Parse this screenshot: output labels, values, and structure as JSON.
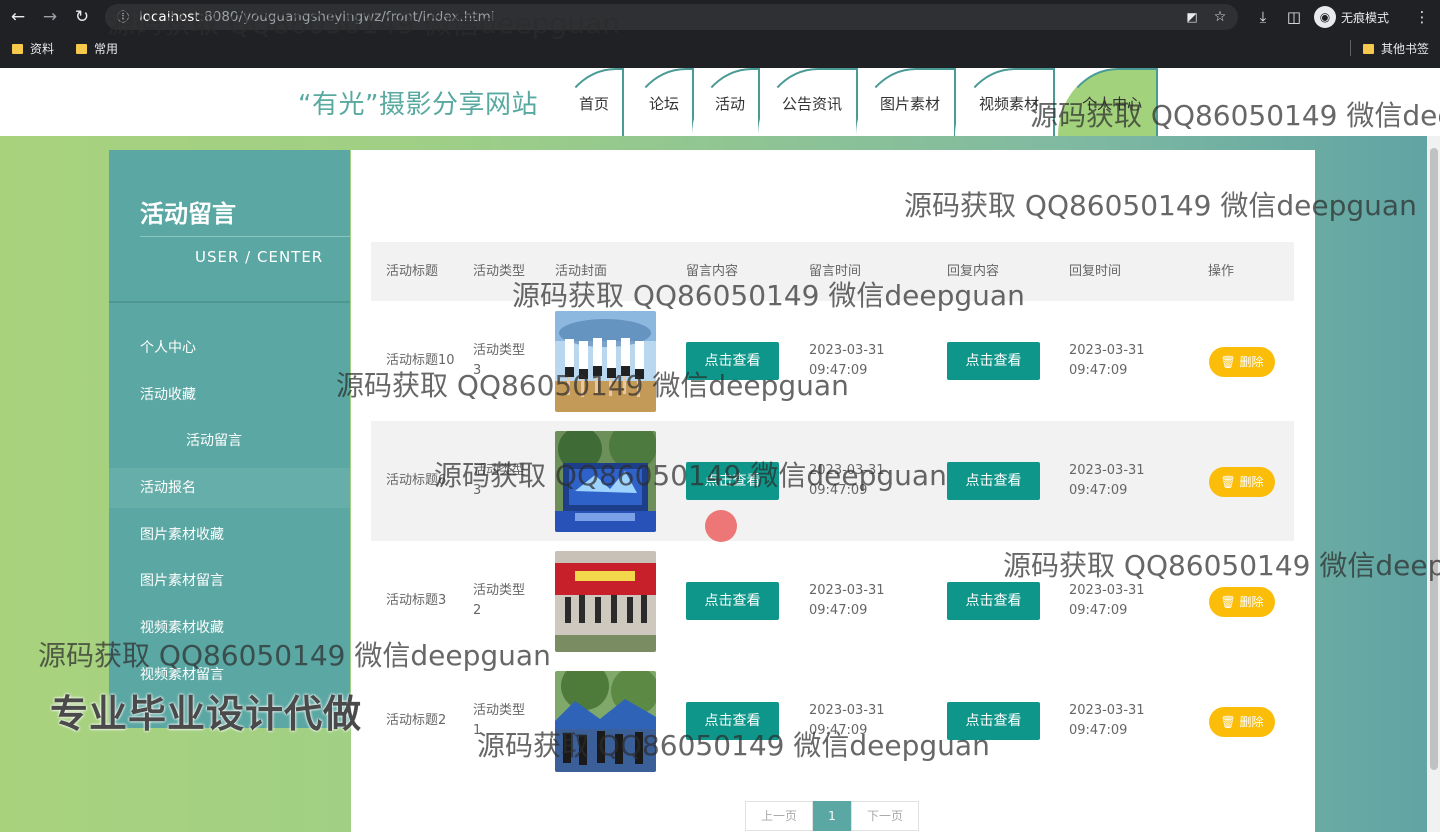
{
  "browser": {
    "url_host": "localhost",
    "url_path": ":8080/youguangsheyingwz/front/index.html",
    "incognito_label": "无痕模式",
    "bookmarks": [
      "资料",
      "常用"
    ],
    "other_bookmarks": "其他书签"
  },
  "site": {
    "title": "“有光”摄影分享网站",
    "nav": [
      "首页",
      "论坛",
      "活动",
      "公告资讯",
      "图片素材",
      "视频素材",
      "个人中心"
    ]
  },
  "sidebar": {
    "title": "活动留言",
    "subtitle": "USER / CENTER",
    "items": [
      "个人中心",
      "活动收藏",
      "活动留言",
      "活动报名",
      "图片素材收藏",
      "图片素材留言",
      "视频素材收藏",
      "视频素材留言"
    ]
  },
  "table": {
    "headers": [
      "活动标题",
      "活动类型",
      "活动封面",
      "留言内容",
      "留言时间",
      "回复内容",
      "回复时间",
      "操作"
    ],
    "rows": [
      {
        "title": "活动标题10",
        "type": "活动类型3",
        "view1": "点击查看",
        "msg_time": "2023-03-31 09:47:09",
        "view2": "点击查看",
        "reply_time": "2023-03-31 09:47:09",
        "delete": "删除"
      },
      {
        "title": "活动标题6",
        "type": "活动类型3",
        "view1": "点击查看",
        "msg_time": "2023-03-31 09:47:09",
        "view2": "点击查看",
        "reply_time": "2023-03-31 09:47:09",
        "delete": "删除"
      },
      {
        "title": "活动标题3",
        "type": "活动类型2",
        "view1": "点击查看",
        "msg_time": "2023-03-31 09:47:09",
        "view2": "点击查看",
        "reply_time": "2023-03-31 09:47:09",
        "delete": "删除"
      },
      {
        "title": "活动标题2",
        "type": "活动类型1",
        "view1": "点击查看",
        "msg_time": "2023-03-31 09:47:09",
        "view2": "点击查看",
        "reply_time": "2023-03-31 09:47:09",
        "delete": "删除"
      }
    ]
  },
  "pager": {
    "prev": "上一页",
    "current": "1",
    "next": "下一页"
  },
  "overlay": {
    "watermark": "源码获取 QQ86050149 微信deepguan",
    "promo": "专业毕业设计代做"
  },
  "colors": {
    "accent": "#0f968a",
    "sidebar": "#5ba7a3",
    "delete": "#fbbd08",
    "nav_active": "#a2d27c"
  }
}
